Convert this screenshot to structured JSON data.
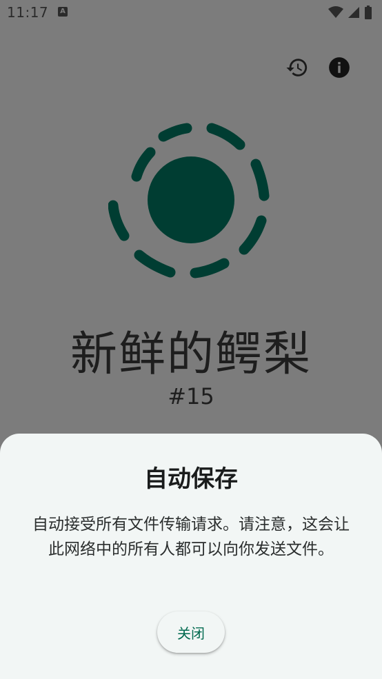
{
  "status_bar": {
    "time": "11:17",
    "notification_letter": "A",
    "icons": [
      "wifi-icon",
      "signal-icon",
      "battery-icon"
    ]
  },
  "toolbar": {
    "icons": [
      "history-icon",
      "info-icon"
    ]
  },
  "device": {
    "name": "新鲜的鳄梨",
    "number": "#15"
  },
  "dialog": {
    "title": "自动保存",
    "body": "自动接受所有文件传输请求。请注意，这会让此网络中的所有人都可以向你发送文件。",
    "close_label": "关闭"
  },
  "colors": {
    "scrim_background": "#7c7c7c",
    "logo_color": "#003d32",
    "sheet_background": "#f2f6f5",
    "accent": "#00694e"
  }
}
